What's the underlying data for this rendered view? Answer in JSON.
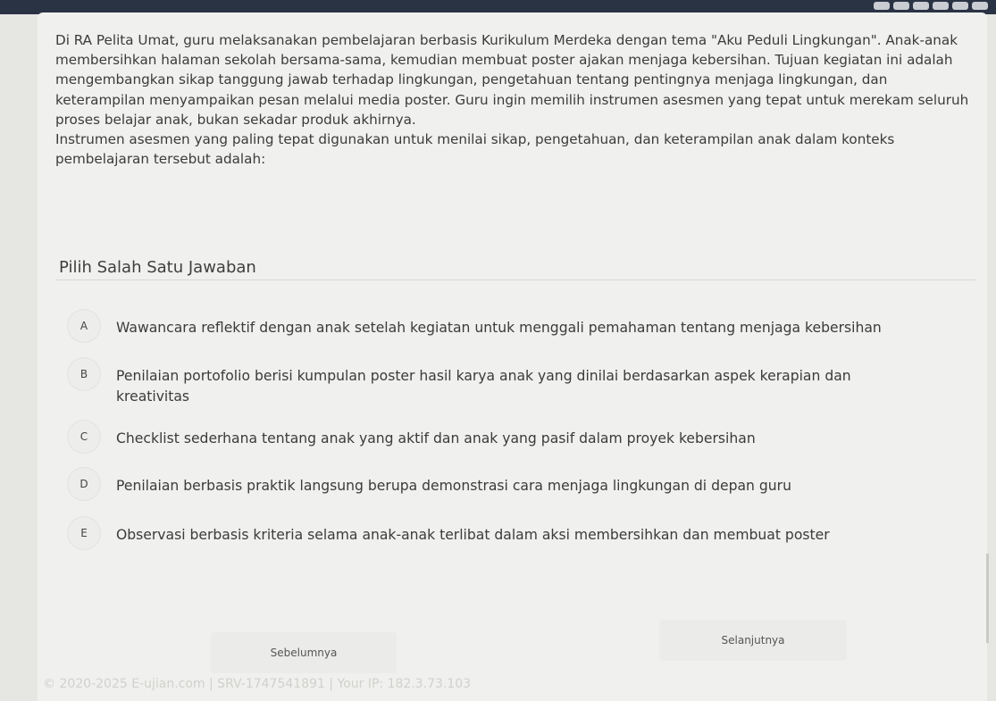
{
  "question": {
    "paragraph1": "Di RA Pelita Umat, guru melaksanakan pembelajaran berbasis Kurikulum Merdeka dengan tema \"Aku Peduli Lingkungan\". Anak-anak membersihkan halaman sekolah bersama-sama, kemudian membuat poster ajakan menjaga kebersihan. Tujuan kegiatan ini adalah mengembangkan sikap tanggung jawab terhadap lingkungan, pengetahuan tentang pentingnya menjaga lingkungan, dan keterampilan menyampaikan pesan melalui media poster. Guru ingin memilih instrumen asesmen yang tepat untuk merekam seluruh proses belajar anak, bukan sekadar produk akhirnya.",
    "paragraph2": "Instrumen asesmen yang paling tepat digunakan untuk menilai sikap, pengetahuan, dan keterampilan anak dalam konteks pembelajaran tersebut adalah:"
  },
  "answers": {
    "title": "Pilih Salah Satu Jawaban",
    "options": [
      {
        "letter": "A",
        "text": "Wawancara reflektif dengan anak setelah kegiatan untuk menggali pemahaman tentang menjaga kebersihan"
      },
      {
        "letter": "B",
        "text": "Penilaian portofolio berisi kumpulan poster hasil karya anak yang dinilai berdasarkan aspek kerapian dan kreativitas"
      },
      {
        "letter": "C",
        "text": "Checklist sederhana tentang anak yang aktif dan anak yang pasif dalam proyek kebersihan"
      },
      {
        "letter": "D",
        "text": "Penilaian berbasis praktik langsung berupa demonstrasi cara menjaga lingkungan di depan guru"
      },
      {
        "letter": "E",
        "text": "Observasi berbasis kriteria selama anak-anak terlibat dalam aksi membersihkan dan membuat poster"
      }
    ]
  },
  "nav": {
    "prev_label": "Sebelumnya",
    "next_label": "Selanjutnya"
  },
  "footer": {
    "text": "© 2020-2025 E-ujian.com | SRV-1747541891 | Your IP: 182.3.73.103"
  },
  "colors": {
    "topbar": "#2a3344",
    "card": "#f0f0ee",
    "text": "#3b3b3b"
  }
}
